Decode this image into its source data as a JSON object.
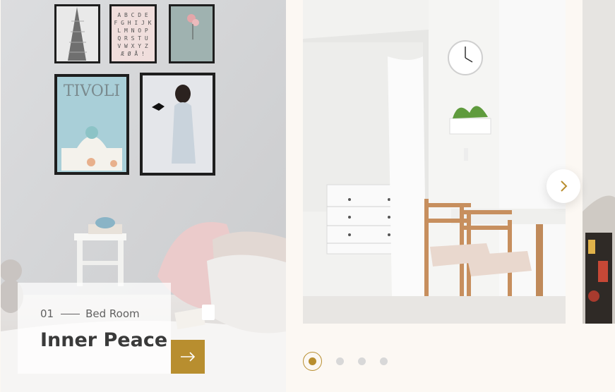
{
  "slides": [
    {
      "index": "01",
      "category": "Bed Room",
      "title": "Inner Peace"
    },
    {
      "image": "dining-room-photo"
    },
    {
      "image": "partial-room-photo"
    }
  ],
  "poster_letters": [
    "A B C D E",
    "F G H I J K",
    "L M N O P",
    "Q R S T U",
    "V W X Y Z",
    "Æ Ø Å !"
  ],
  "poster_title": "TIVOLI",
  "pagination": {
    "count": 4,
    "active": 1
  },
  "colors": {
    "accent": "#B88E2F",
    "background": "#FCF8F3",
    "dot_inactive": "#D8D8D8",
    "title_text": "#3A3A3A"
  },
  "icons": {
    "go": "arrow-right-icon",
    "next": "chevron-right-icon"
  }
}
